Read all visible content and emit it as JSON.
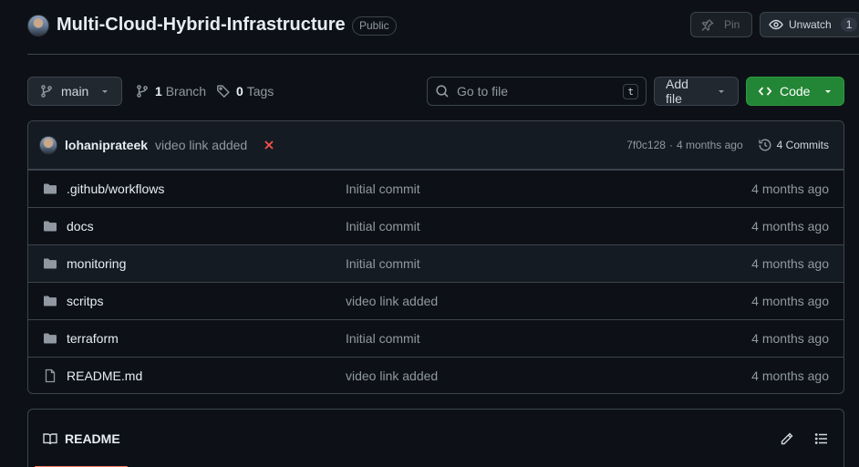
{
  "repo": {
    "name": "Multi-Cloud-Hybrid-Infrastructure",
    "visibility": "Public",
    "pin_label": "Pin",
    "watch_label": "Unwatch",
    "watch_count": "1"
  },
  "toolbar": {
    "branch": "main",
    "branch_count": "1",
    "branch_label": "Branch",
    "tag_count": "0",
    "tag_label": "Tags",
    "search_placeholder": "Go to file",
    "search_shortcut": "t",
    "add_file_label": "Add file",
    "code_label": "Code"
  },
  "latest_commit": {
    "author": "lohaniprateek",
    "message": "video link added",
    "status": "failed",
    "sha": "7f0c128",
    "separator": "·",
    "age": "4 months ago",
    "commits_label": "4 Commits"
  },
  "files": [
    {
      "name": ".github/workflows",
      "type": "folder",
      "message": "Initial commit",
      "age": "4 months ago"
    },
    {
      "name": "docs",
      "type": "folder",
      "message": "Initial commit",
      "age": "4 months ago"
    },
    {
      "name": "monitoring",
      "type": "folder",
      "message": "Initial commit",
      "age": "4 months ago"
    },
    {
      "name": "scritps",
      "type": "folder",
      "message": "video link added",
      "age": "4 months ago"
    },
    {
      "name": "terraform",
      "type": "folder",
      "message": "Initial commit",
      "age": "4 months ago"
    },
    {
      "name": "README.md",
      "type": "file",
      "message": "video link added",
      "age": "4 months ago"
    }
  ],
  "readme": {
    "tab_label": "README"
  },
  "colors": {
    "background": "#0d1117",
    "accent_green": "#238636",
    "fail_red": "#f85149",
    "tab_underline": "#f78166"
  }
}
